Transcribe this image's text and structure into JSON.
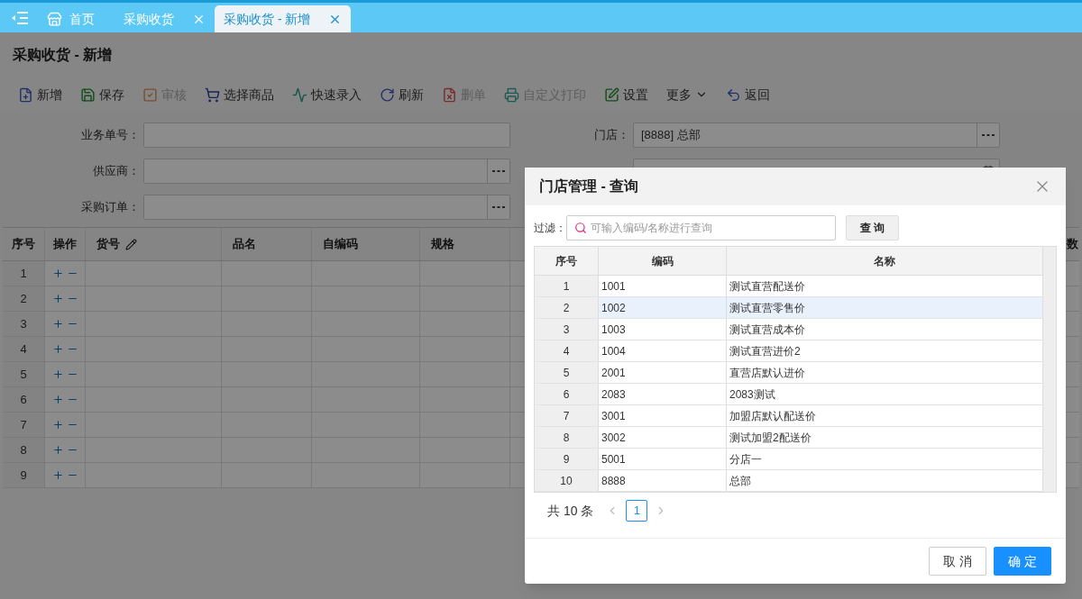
{
  "tabs": [
    {
      "label": "首页",
      "kind": "home",
      "selected": false
    },
    {
      "label": "采购收货",
      "kind": "closable",
      "selected": false
    },
    {
      "label": "采购收货 - 新增",
      "kind": "closable",
      "selected": true
    }
  ],
  "page_title": "采购收货 - 新增",
  "toolbar": [
    {
      "label": "新增",
      "kind": "new",
      "disabled": false
    },
    {
      "label": "保存",
      "kind": "save",
      "disabled": false
    },
    {
      "label": "审核",
      "kind": "check",
      "disabled": true
    },
    {
      "label": "选择商品",
      "kind": "cart",
      "disabled": false
    },
    {
      "label": "快速录入",
      "kind": "pulse",
      "disabled": false
    },
    {
      "label": "刷新",
      "kind": "refresh",
      "disabled": false
    },
    {
      "label": "删单",
      "kind": "delete",
      "disabled": true
    },
    {
      "label": "自定义打印",
      "kind": "print",
      "disabled": true
    },
    {
      "label": "设置",
      "kind": "settings",
      "disabled": false
    },
    {
      "label": "更多",
      "kind": "more",
      "disabled": false
    },
    {
      "label": "返回",
      "kind": "back",
      "disabled": false
    }
  ],
  "form": {
    "left": [
      {
        "label": "业务单号：",
        "kind": "text"
      },
      {
        "label": "供应商：",
        "kind": "lookup"
      },
      {
        "label": "采购订单：",
        "kind": "lookup"
      }
    ],
    "right": [
      {
        "label": "门店：",
        "kind": "lookup",
        "value": "[8888] 总部"
      },
      {
        "kind": "date"
      }
    ]
  },
  "grid": {
    "columns": [
      {
        "label": "序号",
        "kind": "index"
      },
      {
        "label": "操作",
        "kind": "ops"
      },
      {
        "label": "货号",
        "kind": "editable"
      },
      {
        "label": "品名",
        "kind": "plain"
      },
      {
        "label": "自编码",
        "kind": "plain"
      },
      {
        "label": "规格",
        "kind": "plain"
      },
      {
        "kind": "plain"
      },
      {
        "label": "数",
        "kind": "tail"
      }
    ],
    "rows": [
      "1",
      "2",
      "3",
      "4",
      "5",
      "6",
      "7",
      "8",
      "9"
    ]
  },
  "dialog": {
    "title": "门店管理 - 查询",
    "filter_label": "过滤：",
    "filter_placeholder": "可输入编码/名称进行查询",
    "search_button": "查 询",
    "columns": [
      "序号",
      "编码",
      "名称"
    ],
    "rows": [
      {
        "index": "1",
        "code": "1001",
        "name": "测试直营配送价",
        "selected": false
      },
      {
        "index": "2",
        "code": "1002",
        "name": "测试直营零售价",
        "selected": true
      },
      {
        "index": "3",
        "code": "1003",
        "name": "测试直营成本价",
        "selected": false
      },
      {
        "index": "4",
        "code": "1004",
        "name": "测试直营进价2",
        "selected": false
      },
      {
        "index": "5",
        "code": "2001",
        "name": "直营店默认进价",
        "selected": false
      },
      {
        "index": "6",
        "code": "2083",
        "name": "2083测试",
        "selected": false
      },
      {
        "index": "7",
        "code": "3001",
        "name": "加盟店默认配送价",
        "selected": false
      },
      {
        "index": "8",
        "code": "3002",
        "name": "测试加盟2配送价",
        "selected": false
      },
      {
        "index": "9",
        "code": "5001",
        "name": "分店一",
        "selected": false
      },
      {
        "index": "10",
        "code": "8888",
        "name": "总部",
        "selected": false
      }
    ],
    "total": "共 10 条",
    "pages": [
      {
        "label": "1",
        "selected": true
      }
    ],
    "buttons": [
      {
        "label": "取 消",
        "kind": "secondary"
      },
      {
        "label": "确 定",
        "kind": "primary"
      }
    ]
  }
}
